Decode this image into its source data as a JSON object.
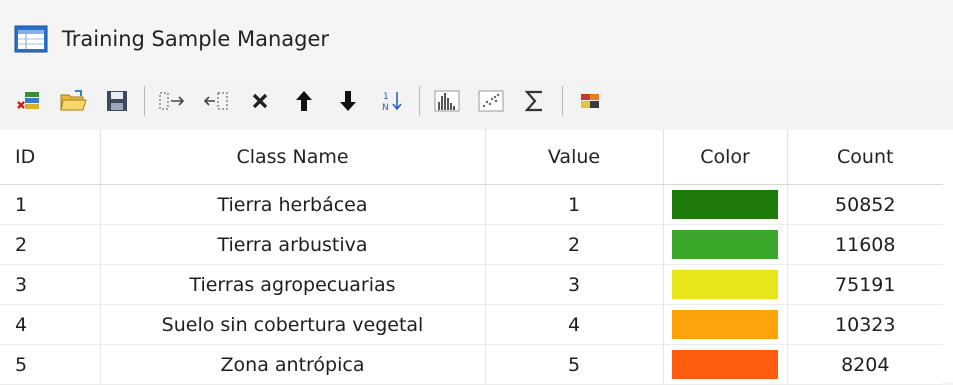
{
  "window": {
    "title": "Training Sample Manager"
  },
  "toolbar": {
    "buttons": [
      {
        "icon": "delete-all-icon"
      },
      {
        "icon": "open-folder-icon"
      },
      {
        "icon": "save-icon"
      },
      {
        "icon": "merge-icon"
      },
      {
        "icon": "split-icon"
      },
      {
        "icon": "delete-icon"
      },
      {
        "icon": "move-up-icon"
      },
      {
        "icon": "move-down-icon"
      },
      {
        "icon": "sort-icon"
      },
      {
        "icon": "histogram-icon"
      },
      {
        "icon": "scatterplot-icon"
      },
      {
        "icon": "sum-icon"
      },
      {
        "icon": "export-icon"
      }
    ]
  },
  "table": {
    "columns": [
      "ID",
      "Class Name",
      "Value",
      "Color",
      "Count"
    ],
    "rows": [
      {
        "id": "1",
        "name": "Tierra herbácea",
        "value": "1",
        "color": "#1f7a0c",
        "count": "50852"
      },
      {
        "id": "2",
        "name": "Tierra arbustiva",
        "value": "2",
        "color": "#3ba82b",
        "count": "11608"
      },
      {
        "id": "3",
        "name": "Tierras agropecuarias",
        "value": "3",
        "color": "#e6e61a",
        "count": "75191"
      },
      {
        "id": "4",
        "name": "Suelo sin cobertura vegetal",
        "value": "4",
        "color": "#ffa30a",
        "count": "10323"
      },
      {
        "id": "5",
        "name": "Zona antrópica",
        "value": "5",
        "color": "#ff5c10",
        "count": "8204"
      }
    ]
  }
}
